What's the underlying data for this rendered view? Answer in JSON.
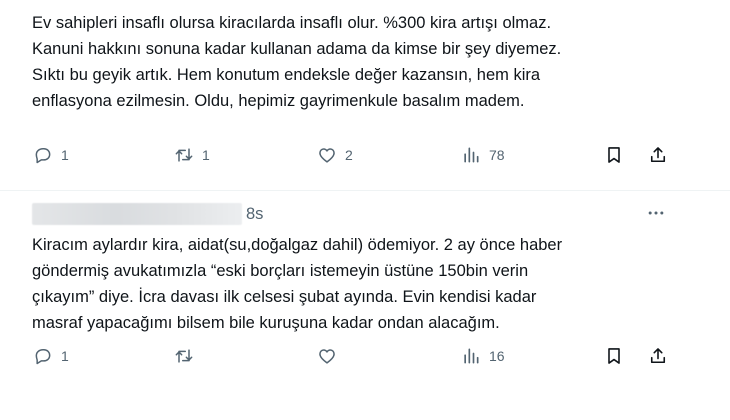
{
  "tweets": [
    {
      "lines": [
        "Ev sahipleri insaflı olursa kiracılarda insaflı olur. %300 kira artışı olmaz.",
        "Kanuni hakkını sonuna kadar kullanan adama da kimse bir şey diyemez.",
        "Sıktı bu geyik artık. Hem konutum endeksle değer kazansın, hem kira",
        "enflasyona ezilmesin. Oldu, hepimiz gayrimenkule basalım madem."
      ],
      "replies": "1",
      "reposts": "1",
      "likes": "2",
      "views": "78"
    },
    {
      "timestamp": "8s",
      "lines": [
        "Kiracım aylardır kira, aidat(su,doğalgaz dahil) ödemiyor. 2 ay önce haber",
        "göndermiş avukatımızla “eski borçları istemeyin üstüne 150bin verin",
        "çıkayım” diye. İcra davası ilk celsesi şubat ayında. Evin kendisi kadar",
        "masraf yapacağımı bilsem bile kuruşuna kadar ondan alacağım."
      ],
      "replies": "1",
      "reposts": "",
      "likes": "",
      "views": "16"
    }
  ],
  "icons": {
    "reply": "reply-icon",
    "repost": "repost-icon",
    "like": "heart-icon",
    "views": "views-icon",
    "bookmark": "bookmark-icon",
    "share": "share-icon",
    "more": "more-icon"
  },
  "colors": {
    "text": "#0f1419",
    "secondary": "#536471",
    "divider": "#eff3f4"
  }
}
